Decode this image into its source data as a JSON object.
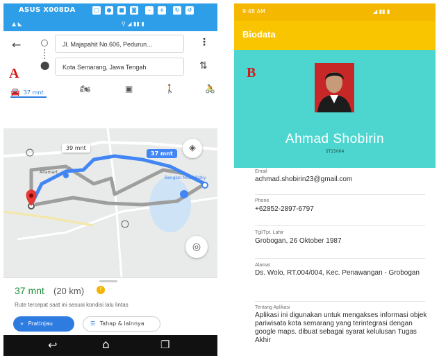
{
  "panel_a": {
    "letter": "A",
    "device_title": "ASUS X008DA",
    "search": {
      "origin": "Jl. Majapahit No.606, Pedurun…",
      "destination": "Kota Semarang, Jawa Tengah"
    },
    "modes": {
      "car_time": "37 mnt"
    },
    "map": {
      "alt_label": "39 mnt",
      "route_label": "37 mnt",
      "place1": "Alfamart",
      "place2": "Bengkel Mobil Rizky"
    },
    "result": {
      "duration": "37 mnt",
      "distance": "(20 km)",
      "note": "Rute tercepat saat ini sesuai kondisi lalu lintas"
    },
    "buttons": {
      "start": "Pratinjau",
      "steps": "Tahap & lainnya"
    }
  },
  "panel_b": {
    "letter": "B",
    "status_time": "9:48 AM",
    "app_title": "Biodata",
    "name": "Ahmad Shobirin",
    "id": "ST15004",
    "fields": [
      {
        "label": "Email",
        "value": "achmad.shobirin23@gmail.com"
      },
      {
        "label": "Phone",
        "value": "+62852-2897-6797"
      },
      {
        "label": "Tgl/Tpt. Lahir",
        "value": "Grobogan, 26 Oktober 1987"
      },
      {
        "label": "Alamat",
        "value": "Ds. Wolo, RT.004/004, Kec. Penawangan - Grobogan"
      },
      {
        "label": "Tentang Aplikasi",
        "value": "Aplikasi ini digunakan untuk mengakses informasi objek pariwisata kota semarang yang terintegrasi dengan google maps. dibuat sebagai syarat kelulusan Tugas Akhir"
      }
    ]
  },
  "colors": {
    "maps_blue": "#2f9ee8",
    "route_blue": "#4285f4",
    "biodata_yellow": "#f9c400",
    "biodata_teal": "#4dd6cf",
    "pin_red": "#e53935"
  }
}
